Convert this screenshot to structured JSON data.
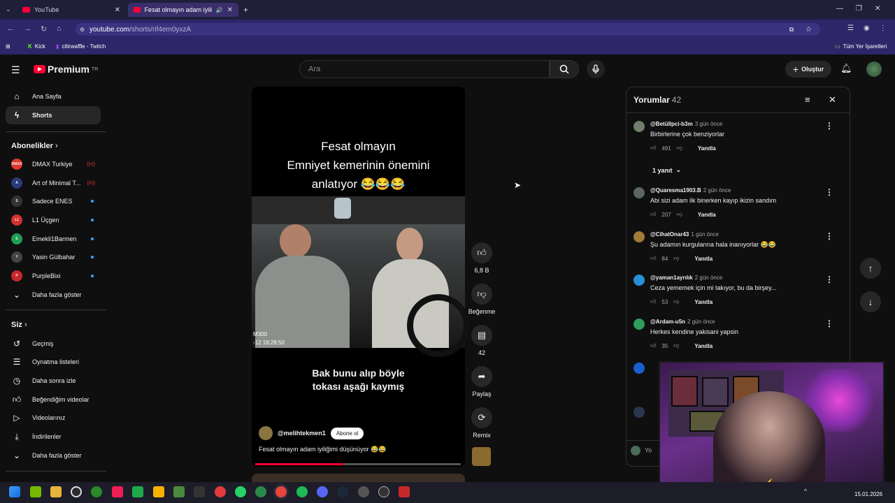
{
  "browser": {
    "tabs": [
      {
        "label": "YouTube"
      },
      {
        "label": "Fesat olmayın adam iyiliğini"
      }
    ],
    "url_host": "youtube.com",
    "url_path": "/shorts/rif4em0yxzA",
    "bookmarks": [
      {
        "label": "Kick"
      },
      {
        "label": "citirwaffle - Twitch"
      }
    ],
    "all_bookmarks": "Tüm Yer İşaretleri"
  },
  "header": {
    "logo_text": "Premium",
    "region": "TR",
    "search_placeholder": "Ara",
    "create_label": "Oluştur"
  },
  "sidebar": {
    "home": "Ana Sayfa",
    "shorts": "Shorts",
    "subscriptions_title": "Abonelikler",
    "channels": [
      {
        "name": "DMAX Turkiye",
        "badge": "DMAX",
        "color": "#e0382b",
        "status": "live"
      },
      {
        "name": "Art of Minimal T...",
        "badge": "A",
        "color": "#2a3a7a",
        "status": "live"
      },
      {
        "name": "Sadece ENES",
        "badge": "S",
        "color": "#333333",
        "status": "new"
      },
      {
        "name": "L1 Üçgen",
        "badge": "L1",
        "color": "#d33030",
        "status": "new"
      },
      {
        "name": "Emekli1Barmen",
        "badge": "E",
        "color": "#1f9d55",
        "status": "new"
      },
      {
        "name": "Yasin Gülbahar",
        "badge": "Y",
        "color": "#444444",
        "status": "new"
      },
      {
        "name": "PurpleBixi",
        "badge": "P",
        "color": "#c8262d",
        "status": "new"
      }
    ],
    "show_more": "Daha fazla göster",
    "you_title": "Siz",
    "you_items": [
      "Geçmiş",
      "Oynatma listeleri",
      "Daha sonra izle",
      "Beğendiğim videolar",
      "Videolarınız",
      "İndirilenler"
    ],
    "show_more_2": "Daha fazla göster"
  },
  "short": {
    "caption_lines": [
      "Fesat olmayın",
      "Emniyet kemerinin önemini",
      "anlatıyor 😂😂😂"
    ],
    "subtitle_lines": [
      "Bak bunu alıp böyle",
      "tokası aşağı kaymış"
    ],
    "cam_model": "M300",
    "cam_time": "-12    18:28:50",
    "channel": "@melihtekmen1",
    "subscribe": "Abone ol",
    "title": "Fesat olmayın adam iyiliğimi düşünüyor 😂😂",
    "progress": 0.43
  },
  "actions": {
    "likes": "6,8 B",
    "dislike": "Beğenme",
    "comments": "42",
    "share": "Paylaş",
    "remix": "Remix"
  },
  "comments_panel": {
    "title": "Yorumlar",
    "count": "42",
    "reply_label": "Yanıtla",
    "replies_toggle": "1 yanıt",
    "input_placeholder": "Yo",
    "items": [
      {
        "user": "@Betüllpci-b3m",
        "time": "3 gün önce",
        "text": "Birbirlerine çok benziyorlar",
        "likes": "491",
        "avatar_color": "#6f7f6a"
      },
      {
        "user": "@Quaresma1903.B",
        "time": "2 gün önce",
        "text": "Abi sizi adam ilk binerken kayıp ikizin sandım",
        "likes": "207",
        "avatar_color": "#5b6660"
      },
      {
        "user": "@CihatOnar43",
        "time": "1 gün önce",
        "text": "Şu adamın kurgularına hala inanıyorlar 😂😂",
        "likes": "84",
        "avatar_color": "#a07a36"
      },
      {
        "user": "@yaman1ayrılık",
        "time": "2 gün önce",
        "text": "Ceza yememek için mi takıyor, bu da birşey...",
        "likes": "53",
        "avatar_color": "#2a8fd8"
      },
      {
        "user": "@Ardam-u5n",
        "time": "2 gün önce",
        "text": "Herkes kendine yakisani yapsin",
        "likes": "35",
        "avatar_color": "#2e9e5a"
      }
    ]
  },
  "taskbar": {
    "date": "15.01.2026"
  }
}
